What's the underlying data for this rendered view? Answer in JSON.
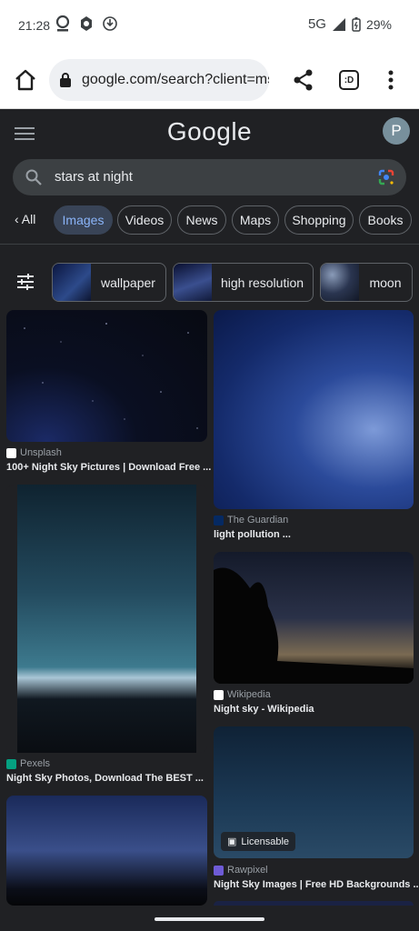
{
  "status_bar": {
    "time": "21:28",
    "network": "5G",
    "battery": "29%"
  },
  "browser": {
    "url": "google.com/search?client=ms",
    "tabs_count": ":D"
  },
  "google": {
    "logo": "Google",
    "avatar_letter": "P"
  },
  "search": {
    "query": "stars at night"
  },
  "filters": {
    "back_label": "All",
    "tabs": [
      "Images",
      "Videos",
      "News",
      "Maps",
      "Shopping",
      "Books"
    ],
    "active": "Images"
  },
  "related": [
    {
      "label": "wallpaper"
    },
    {
      "label": "high resolution"
    },
    {
      "label": "moon"
    }
  ],
  "results": [
    {
      "source": "Unsplash",
      "title": "100+ Night Sky Pictures | Download Free ..."
    },
    {
      "source": "The Guardian",
      "title": "light pollution ..."
    },
    {
      "source": "Pexels",
      "title": "Night Sky Photos, Download The BEST ..."
    },
    {
      "source": "Wikipedia",
      "title": "Night sky - Wikipedia"
    },
    {
      "source": "Rawpixel",
      "title": "Night Sky Images | Free HD Backgrounds ...",
      "badge": "Licensable"
    }
  ],
  "colors": {
    "background": "#202124",
    "active_chip_bg": "#394457",
    "active_chip_text": "#8ab4f8"
  }
}
